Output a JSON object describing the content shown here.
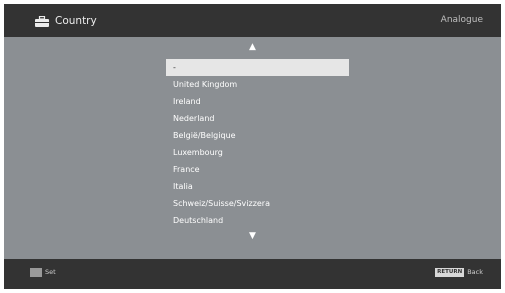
{
  "header": {
    "icon": "toolbox-icon",
    "title": "Country",
    "mode": "Analogue"
  },
  "list": {
    "scroll_up_icon": "▲",
    "scroll_down_icon": "▼",
    "items": [
      {
        "label": "-",
        "selected": true
      },
      {
        "label": "United Kingdom"
      },
      {
        "label": "Ireland"
      },
      {
        "label": "Nederland"
      },
      {
        "label": "België/Belgique"
      },
      {
        "label": "Luxembourg"
      },
      {
        "label": "France"
      },
      {
        "label": "Italia"
      },
      {
        "label": "Schweiz/Suisse/Svizzera"
      },
      {
        "label": "Deutschland"
      }
    ]
  },
  "footer": {
    "set_label": "Set",
    "return_key": "RETURN",
    "back_label": "Back"
  },
  "colors": {
    "background": "#8b8f93",
    "bars": "#333333",
    "highlight": "#e6e6e6"
  }
}
